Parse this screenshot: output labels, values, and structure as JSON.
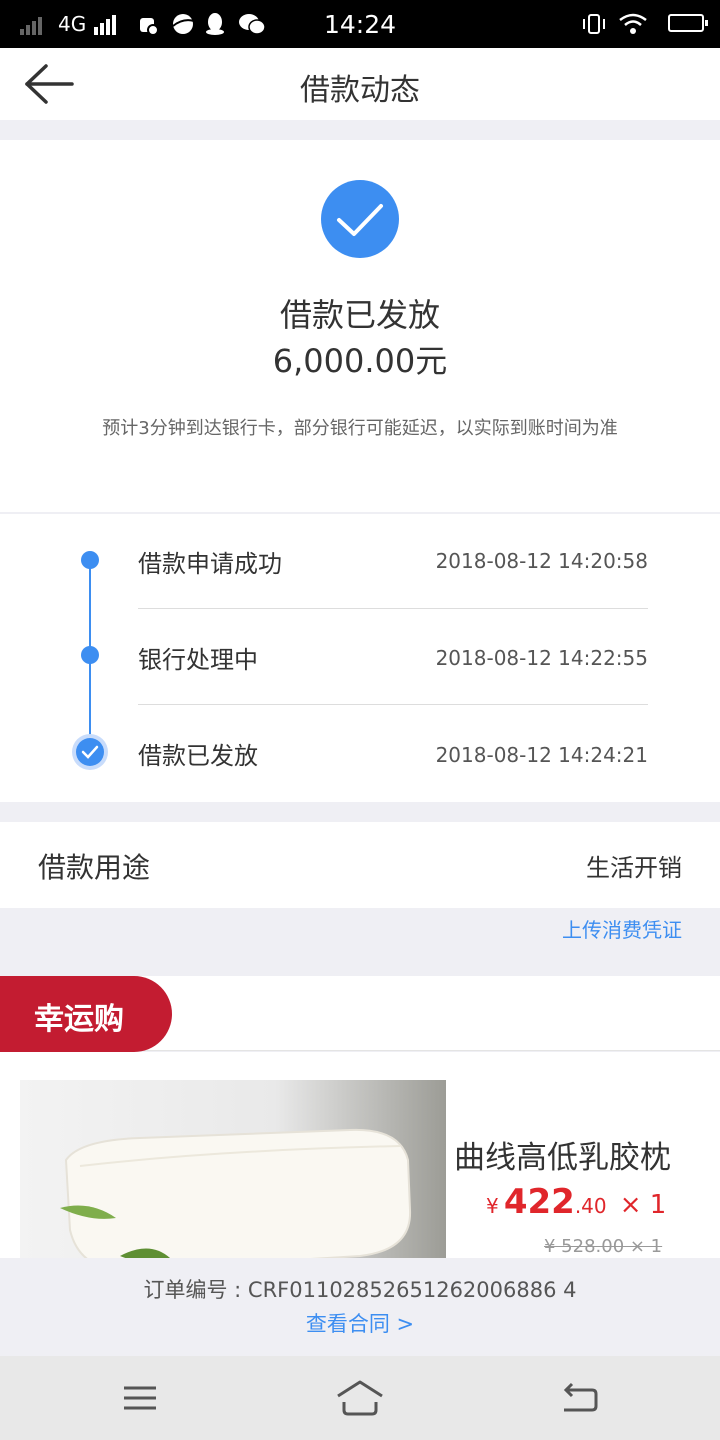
{
  "status_bar": {
    "network": "4G",
    "time": "14:24"
  },
  "header": {
    "title": "借款动态"
  },
  "status_card": {
    "title": "借款已发放",
    "amount": "6,000.00元",
    "note": "预计3分钟到达银行卡，部分银行可能延迟，以实际到账时间为准"
  },
  "timeline": [
    {
      "label": "借款申请成功",
      "time": "2018-08-12 14:20:58"
    },
    {
      "label": "银行处理中",
      "time": "2018-08-12 14:22:55"
    },
    {
      "label": "借款已发放",
      "time": "2018-08-12 14:24:21"
    }
  ],
  "purpose": {
    "label": "借款用途",
    "value": "生活开销",
    "upload_link": "上传消费凭证"
  },
  "lucky_buy": {
    "badge": "幸运购",
    "product": {
      "name": "曲线高低乳胶枕",
      "currency": "¥",
      "price_int": "422",
      "price_dec": ".40",
      "quantity": "× 1",
      "original_price": "¥ 528.00 × 1"
    }
  },
  "order": {
    "number": "订单编号 : CRF01102852651262006886 4",
    "contract_link": "查看合同 >"
  },
  "colors": {
    "accent": "#3d8ef1",
    "badge": "#c31c31",
    "price": "#e0262b"
  },
  "icons": {
    "back": "back-arrow-icon",
    "success": "check-circle-icon",
    "nav_menu": "menu-icon",
    "nav_home": "home-icon",
    "nav_back": "return-icon"
  }
}
